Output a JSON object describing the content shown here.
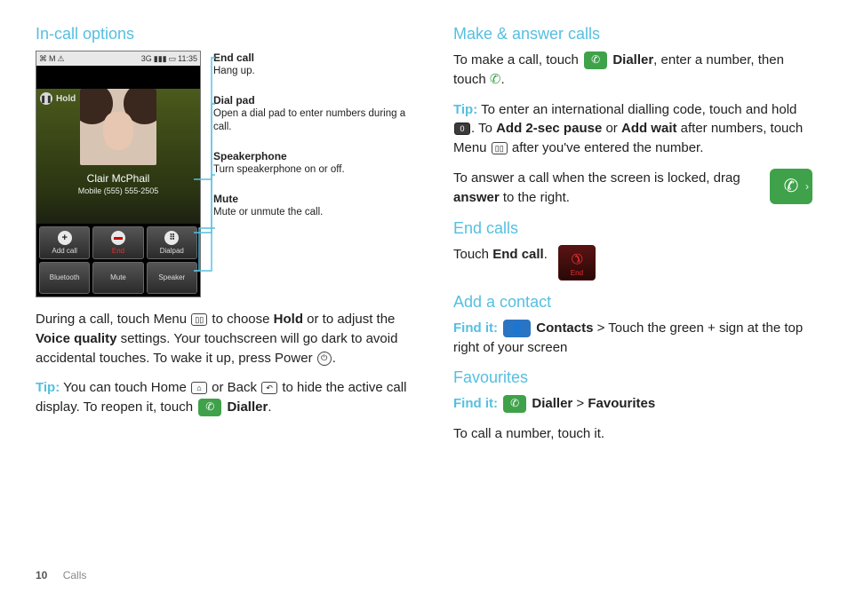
{
  "left": {
    "heading": "In-call options",
    "phone": {
      "status_time": "11:35",
      "status_3g": "3G",
      "hold_label": "Hold",
      "caller_name": "Clair McPhail",
      "caller_sub": "Mobile  (555) 555-2505",
      "buttons": {
        "add_call": "Add call",
        "end": "End",
        "dialpad": "Dialpad",
        "bluetooth": "Bluetooth",
        "mute": "Mute",
        "speaker": "Speaker"
      }
    },
    "callouts": [
      {
        "title": "End call",
        "body": "Hang up."
      },
      {
        "title": "Dial pad",
        "body": "Open a dial pad to enter numbers during a call."
      },
      {
        "title": "Speakerphone",
        "body": "Turn speakerphone on or off."
      },
      {
        "title": "Mute",
        "body": "Mute or unmute the call."
      }
    ],
    "para1_pre": "During a call, touch Menu ",
    "para1_mid1": " to choose ",
    "para1_bold1": "Hold",
    "para1_mid2": " or to adjust the ",
    "para1_bold2": "Voice quality",
    "para1_mid3": " settings. Your touchscreen will go dark to avoid accidental touches. To wake it up, press Power ",
    "para1_end": ".",
    "tip_label": "Tip:",
    "tip_pre": " You can touch Home ",
    "tip_mid": " or Back ",
    "tip_post": " to hide the active call display. To reopen it, touch ",
    "dialler_label": "Dialler",
    "tip_end": "."
  },
  "right": {
    "h_make": "Make & answer calls",
    "make_pre": "To make a call, touch ",
    "dialler_label": "Dialler",
    "make_mid": ", enter a number, then touch ",
    "make_end": ".",
    "tip_label": "Tip:",
    "tip2_pre": " To enter an international dialling code, touch and hold ",
    "tip2_mid": ". To ",
    "add2sec": "Add 2-sec pause",
    "tip2_or": " or ",
    "addwait": "Add wait",
    "tip2_post": " after numbers, touch Menu ",
    "tip2_end": " after you've entered the number.",
    "answer_text_pre": "To answer a call when the screen is locked, drag ",
    "answer_bold": "answer",
    "answer_text_post": " to the right.",
    "h_end": "End calls",
    "end_pre": "Touch ",
    "end_bold": "End call",
    "end_post": ".",
    "end_tile_label": "End",
    "h_add": "Add a contact",
    "findit_label": "Find it:",
    "contacts_label": "Contacts",
    "add_post": " > Touch the green + sign at the top right of your screen",
    "h_fav": "Favourites",
    "fav_dialler": "Dialler",
    "fav_gt": " > ",
    "fav_fav": "Favourites",
    "fav_body": "To call a number, touch it."
  },
  "footer": {
    "page": "10",
    "section": "Calls"
  }
}
